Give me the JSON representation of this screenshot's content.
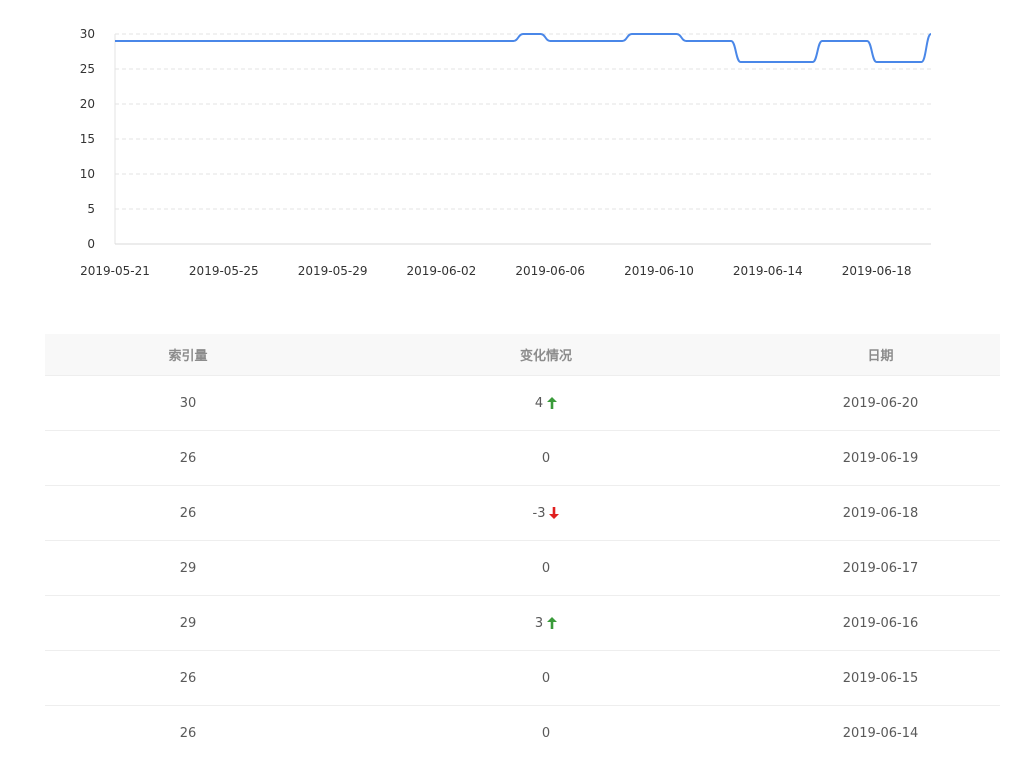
{
  "chart_data": {
    "type": "line",
    "x": [
      "2019-05-21",
      "2019-05-22",
      "2019-05-23",
      "2019-05-24",
      "2019-05-25",
      "2019-05-26",
      "2019-05-27",
      "2019-05-28",
      "2019-05-29",
      "2019-05-30",
      "2019-05-31",
      "2019-06-01",
      "2019-06-02",
      "2019-06-03",
      "2019-06-04",
      "2019-06-05",
      "2019-06-06",
      "2019-06-07",
      "2019-06-08",
      "2019-06-09",
      "2019-06-10",
      "2019-06-11",
      "2019-06-12",
      "2019-06-13",
      "2019-06-14",
      "2019-06-15",
      "2019-06-16",
      "2019-06-17",
      "2019-06-18",
      "2019-06-19",
      "2019-06-20"
    ],
    "series": [
      {
        "values": [
          29,
          29,
          29,
          29,
          29,
          29,
          29,
          29,
          29,
          29,
          29,
          29,
          29,
          29,
          29,
          30,
          29,
          29,
          29,
          30,
          30,
          29,
          29,
          26,
          26,
          26,
          29,
          29,
          26,
          26,
          30
        ]
      }
    ],
    "x_tick_labels": [
      "2019-05-21",
      "2019-05-25",
      "2019-05-29",
      "2019-06-02",
      "2019-06-06",
      "2019-06-10",
      "2019-06-14",
      "2019-06-18"
    ],
    "y_ticks": [
      0,
      5,
      10,
      15,
      20,
      25,
      30
    ],
    "ylim": [
      0,
      30
    ],
    "grid": true,
    "line_color": "#4a87e8"
  },
  "table": {
    "headers": [
      "索引量",
      "变化情况",
      "日期"
    ],
    "rows": [
      {
        "count": "30",
        "change": "4",
        "direction": "up",
        "date": "2019-06-20"
      },
      {
        "count": "26",
        "change": "0",
        "direction": "none",
        "date": "2019-06-19"
      },
      {
        "count": "26",
        "change": "-3",
        "direction": "down",
        "date": "2019-06-18"
      },
      {
        "count": "29",
        "change": "0",
        "direction": "none",
        "date": "2019-06-17"
      },
      {
        "count": "29",
        "change": "3",
        "direction": "up",
        "date": "2019-06-16"
      },
      {
        "count": "26",
        "change": "0",
        "direction": "none",
        "date": "2019-06-15"
      },
      {
        "count": "26",
        "change": "0",
        "direction": "none",
        "date": "2019-06-14"
      }
    ]
  },
  "colors": {
    "up": "#3a9b3a",
    "down": "#e02020",
    "grid": "#e3e3e3",
    "axis": "#d9d9d9"
  }
}
